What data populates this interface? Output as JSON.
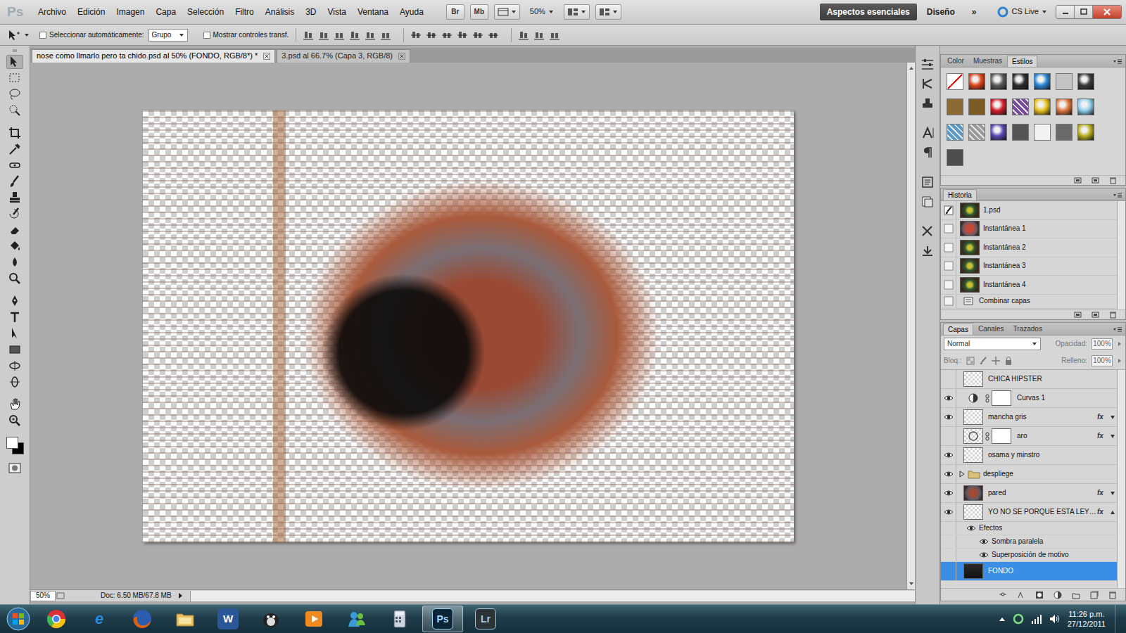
{
  "menu_bar": {
    "logo": "Ps",
    "items": [
      "Archivo",
      "Edición",
      "Imagen",
      "Capa",
      "Selección",
      "Filtro",
      "Análisis",
      "3D",
      "Vista",
      "Ventana",
      "Ayuda"
    ],
    "bridge": "Br",
    "mini_bridge": "Mb",
    "zoom": "50%",
    "workspaces": [
      {
        "label": "Aspectos esenciales",
        "selected": true
      },
      {
        "label": "Diseño",
        "selected": false
      }
    ],
    "more": "»",
    "cs_live": "CS Live"
  },
  "options_bar": {
    "auto_select": {
      "label": "Seleccionar automáticamente:",
      "checked": false
    },
    "auto_select_target": "Grupo",
    "transform_controls": {
      "label": "Mostrar controles transf.",
      "checked": false
    }
  },
  "documents": [
    {
      "label": "nose como llmarlo pero ta chido.psd al 50% (FONDO, RGB/8*) *",
      "selected": true
    },
    {
      "label": "3.psd al 66.7% (Capa 3, RGB/8)",
      "selected": false
    }
  ],
  "colors": {
    "foreground": "#ffffff",
    "background": "#000000"
  },
  "status_bar": {
    "zoom": "50%",
    "doc": "Doc: 6.50 MB/67.8 MB"
  },
  "styles_panel": {
    "tabs": [
      {
        "label": "Color",
        "selected": false
      },
      {
        "label": "Muestras",
        "selected": false
      },
      {
        "label": "Estilos",
        "selected": true
      }
    ],
    "swatches": [
      {
        "color": "#ffffff",
        "kind": "none"
      },
      {
        "color": "#e2461c",
        "kind": "glossy"
      },
      {
        "color": "#5c5c5c",
        "kind": "glossy"
      },
      {
        "color": "#2c2c2c",
        "kind": "glossy"
      },
      {
        "color": "#2a86d6",
        "kind": "glossy"
      },
      {
        "color": "#c4c4c4",
        "kind": "flat"
      },
      {
        "color": "#3c3c3c",
        "kind": "glossy"
      },
      {
        "color": "#8a6a32",
        "kind": "flat"
      },
      {
        "color": "#7c5c24",
        "kind": "flat"
      },
      {
        "color": "#d3202c",
        "kind": "glossy"
      },
      {
        "color": "#7a4a9a",
        "kind": "pattern"
      },
      {
        "color": "#e8c020",
        "kind": "glossy"
      },
      {
        "color": "#e07840",
        "kind": "glossy"
      },
      {
        "color": "#8fd0ee",
        "kind": "glossy"
      },
      {
        "color": "#5a9ac8",
        "kind": "pattern"
      },
      {
        "color": "#9a9a9a",
        "kind": "pattern"
      },
      {
        "color": "#5a4ab0",
        "kind": "glossy"
      },
      {
        "color": "#555555",
        "kind": "flat"
      },
      {
        "color": "#f2f2f2",
        "kind": "flat"
      },
      {
        "color": "#6a6a6a",
        "kind": "flat"
      },
      {
        "color": "#b8b020",
        "kind": "glossy"
      },
      {
        "color": "#4e4e4e",
        "kind": "flat"
      }
    ]
  },
  "history_panel": {
    "tabs": [
      {
        "label": "Historia",
        "selected": true
      }
    ],
    "items": [
      {
        "label": "1.psd",
        "kind": "snapshot",
        "source": true,
        "selected": false
      },
      {
        "label": "Instantánea 1",
        "kind": "snapshot",
        "source": false,
        "selected": false
      },
      {
        "label": "Instantánea 2",
        "kind": "snapshot",
        "source": false,
        "selected": false
      },
      {
        "label": "Instantánea 3",
        "kind": "snapshot",
        "source": false,
        "selected": false
      },
      {
        "label": "Instantánea 4",
        "kind": "snapshot",
        "source": false,
        "selected": false
      },
      {
        "label": "Combinar capas",
        "kind": "step",
        "source": false,
        "selected": false
      }
    ]
  },
  "layers_panel": {
    "tabs": [
      {
        "label": "Capas",
        "selected": true
      },
      {
        "label": "Canales",
        "selected": false
      },
      {
        "label": "Trazados",
        "selected": false
      }
    ],
    "blend_mode": "Normal",
    "opacity_label": "Opacidad:",
    "opacity": "100%",
    "lock_label": "Bloq.:",
    "fill_label": "Relleno:",
    "fill": "100%",
    "rows": [
      {
        "name": "CHICA HIPSTER",
        "kind": "layer",
        "thumb": "transparent",
        "visible": false,
        "mask": false,
        "selected": false
      },
      {
        "name": "Curvas 1",
        "kind": "adjustment",
        "thumb": "adjustment",
        "visible": true,
        "mask": true,
        "selected": false
      },
      {
        "name": "mancha gris",
        "kind": "layer",
        "thumb": "transparent",
        "visible": true,
        "mask": false,
        "fx": "fx",
        "expanded": false,
        "selected": false
      },
      {
        "name": "aro",
        "kind": "layer",
        "thumb": "ring",
        "visible": false,
        "mask": true,
        "fx": "fx",
        "expanded": false,
        "selected": false
      },
      {
        "name": "osama y minstro",
        "kind": "layer",
        "thumb": "transparent",
        "visible": true,
        "mask": false,
        "selected": false
      },
      {
        "name": "despliege",
        "kind": "group",
        "visible": true,
        "expanded": false,
        "selected": false
      },
      {
        "name": "pared",
        "kind": "layer",
        "thumb": "image",
        "visible": true,
        "mask": false,
        "fx": "fx",
        "expanded": false,
        "selected": false
      },
      {
        "name": "YO NO SE PORQUE ESTA LEY…",
        "kind": "layer",
        "thumb": "transparent",
        "visible": true,
        "mask": false,
        "fx": "fx",
        "expanded": true,
        "selected": false
      },
      {
        "name": "Efectos",
        "kind": "effects",
        "visible": true,
        "selected": false
      },
      {
        "name": "Sombra paralela",
        "kind": "effect",
        "visible": true,
        "selected": false
      },
      {
        "name": "Superposición de motivo",
        "kind": "effect",
        "visible": true,
        "selected": false
      },
      {
        "name": "FONDO",
        "kind": "layer",
        "thumb": "dark",
        "visible": false,
        "mask": false,
        "selected": true
      }
    ]
  },
  "taskbar": {
    "apps": [
      {
        "kind": "chrome",
        "selected": false
      },
      {
        "kind": "ie",
        "label": "e",
        "selected": false
      },
      {
        "kind": "firefox",
        "selected": false
      },
      {
        "kind": "explorer",
        "selected": false
      },
      {
        "kind": "word",
        "label": "W",
        "selected": false
      },
      {
        "kind": "app",
        "selected": false
      },
      {
        "kind": "media",
        "selected": false
      },
      {
        "kind": "messenger",
        "selected": false
      },
      {
        "kind": "calculator",
        "selected": false
      },
      {
        "kind": "photoshop",
        "label": "Ps",
        "selected": true
      },
      {
        "kind": "lightroom",
        "label": "Lr",
        "selected": false
      }
    ],
    "time": "11:26 p.m.",
    "date": "27/12/2011"
  }
}
